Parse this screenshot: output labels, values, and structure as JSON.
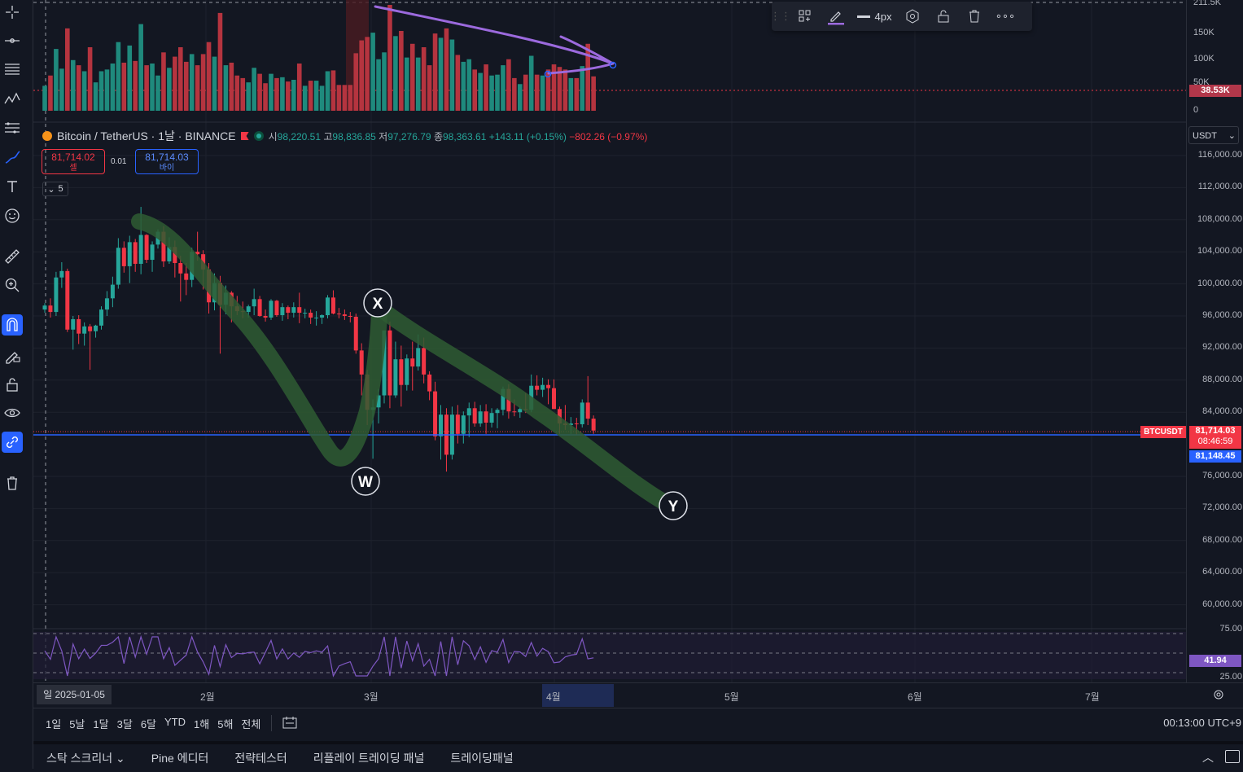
{
  "header": {
    "symbol": "Bitcoin / TetherUS · 1날 · BINANCE",
    "ohlc": {
      "open_label": "시",
      "open": "98,220.51",
      "high_label": "고",
      "high": "98,836.85",
      "low_label": "저",
      "low": "97,276.79",
      "close_label": "종",
      "close": "98,363.61",
      "change": "+143.11 (+0.15%)",
      "change2": "−802.26 (−0.97%)"
    }
  },
  "trade": {
    "sell_price": "81,714.02",
    "sell_label": "셀",
    "spread": "0.01",
    "buy_price": "81,714.03",
    "buy_label": "바이",
    "collapse_count": "5"
  },
  "draw_toolbar": {
    "width_label": "4px"
  },
  "price_axis": {
    "currency": "USDT",
    "labels": [
      "116,000.00",
      "112,000.00",
      "108,000.00",
      "104,000.00",
      "100,000.00",
      "96,000.00",
      "92,000.00",
      "88,000.00",
      "84,000.00",
      "76,000.00",
      "72,000.00",
      "68,000.00",
      "64,000.00",
      "60,000.00"
    ],
    "last_price": "81,714.03",
    "countdown": "08:46:59",
    "line_price": "81,148.45",
    "symbol_tag": "BTCUSDT"
  },
  "volume_axis": {
    "labels": [
      "211.5K",
      "150K",
      "100K",
      "50K",
      "0"
    ],
    "current": "38.53K"
  },
  "rsi_axis": {
    "top": "75.00",
    "bottom": "25.00",
    "value": "41.94"
  },
  "wave_labels": {
    "w": "W",
    "x": "X",
    "y": "Y"
  },
  "time_axis": {
    "current_date": "일 2025-01-05",
    "months": [
      "2월",
      "3월",
      "4월",
      "5월",
      "6월",
      "7월"
    ]
  },
  "range_bar": {
    "buttons": [
      "1일",
      "5날",
      "1달",
      "3달",
      "6달",
      "YTD",
      "1해",
      "5해",
      "전체"
    ],
    "clock": "00:13:00 UTC+9"
  },
  "bottom_tabs": [
    "스탁 스크리너",
    "Pine 에디터",
    "전략테스터",
    "리플레이 트레이딩 패널",
    "트레이딩패널"
  ],
  "colors": {
    "up": "#26a69a",
    "down": "#f23645",
    "accent": "#2962ff",
    "background": "#131722",
    "wave": "#2f5c32",
    "drawing": "#9c6ade"
  },
  "chart_data": {
    "type": "candlestick",
    "title": "Bitcoin / TetherUS · 1날 · BINANCE",
    "ylim": [
      58000,
      118000
    ],
    "x_range": [
      "2025-01-05",
      "2025-07-31"
    ],
    "candles": [
      [
        96800,
        97600,
        96400,
        97300
      ],
      [
        97300,
        98200,
        95800,
        96500
      ],
      [
        96500,
        101500,
        96000,
        100800
      ],
      [
        100800,
        102700,
        99500,
        101600
      ],
      [
        101600,
        101900,
        94000,
        94300
      ],
      [
        94300,
        96000,
        91800,
        95600
      ],
      [
        95600,
        96100,
        92500,
        93800
      ],
      [
        93800,
        95200,
        92300,
        94700
      ],
      [
        94700,
        95000,
        89300,
        94100
      ],
      [
        94100,
        94900,
        93300,
        94800
      ],
      [
        94800,
        97200,
        94300,
        96800
      ],
      [
        96800,
        99100,
        96000,
        98200
      ],
      [
        98200,
        100900,
        97100,
        99900
      ],
      [
        99900,
        105700,
        99400,
        104500
      ],
      [
        104500,
        105300,
        101400,
        102200
      ],
      [
        102200,
        106000,
        100100,
        105200
      ],
      [
        105200,
        105600,
        101500,
        102500
      ],
      [
        102500,
        109600,
        101200,
        106100
      ],
      [
        106100,
        106200,
        102600,
        103000
      ],
      [
        103000,
        105300,
        101500,
        104900
      ],
      [
        104900,
        106800,
        104400,
        106500
      ],
      [
        106500,
        107200,
        102100,
        102800
      ],
      [
        102800,
        105800,
        102500,
        104600
      ],
      [
        104600,
        105400,
        100800,
        102600
      ],
      [
        102600,
        103500,
        97800,
        101300
      ],
      [
        101300,
        102600,
        98600,
        100500
      ],
      [
        100500,
        104500,
        99600,
        104000
      ],
      [
        104000,
        106500,
        102900,
        103700
      ],
      [
        103700,
        104200,
        99300,
        101800
      ],
      [
        101800,
        102600,
        96300,
        97700
      ],
      [
        97700,
        101300,
        96700,
        100100
      ],
      [
        100100,
        101000,
        91300,
        97400
      ],
      [
        97400,
        99800,
        96200,
        98900
      ],
      [
        98900,
        99100,
        95200,
        97200
      ],
      [
        97200,
        98500,
        96100,
        96600
      ],
      [
        96600,
        97800,
        95700,
        96500
      ],
      [
        96500,
        97400,
        95800,
        97200
      ],
      [
        97200,
        99400,
        96100,
        98100
      ],
      [
        98100,
        98500,
        95900,
        96000
      ],
      [
        96000,
        96800,
        95300,
        95800
      ],
      [
        95800,
        98100,
        95500,
        97900
      ],
      [
        97900,
        98000,
        95900,
        96100
      ],
      [
        96100,
        97600,
        95400,
        97100
      ],
      [
        97100,
        97300,
        95600,
        96400
      ],
      [
        96400,
        97700,
        95800,
        97100
      ],
      [
        97100,
        98900,
        95100,
        96400
      ],
      [
        96400,
        96900,
        95700,
        96400
      ],
      [
        96400,
        96800,
        95000,
        95800
      ],
      [
        95800,
        96600,
        94800,
        95800
      ],
      [
        95800,
        96200,
        95000,
        96100
      ],
      [
        96100,
        98600,
        95700,
        98300
      ],
      [
        98300,
        99200,
        96200,
        96300
      ],
      [
        96300,
        97000,
        95700,
        96200
      ],
      [
        96200,
        96800,
        95500,
        96000
      ],
      [
        96000,
        96500,
        95200,
        95900
      ],
      [
        95900,
        96300,
        91300,
        91700
      ],
      [
        91700,
        92600,
        86100,
        88700
      ],
      [
        88700,
        89300,
        82400,
        84300
      ],
      [
        84300,
        85600,
        78200,
        84600
      ],
      [
        84600,
        86900,
        82600,
        86100
      ],
      [
        86100,
        90200,
        85100,
        94200
      ],
      [
        94200,
        95300,
        84500,
        86100
      ],
      [
        86100,
        92800,
        85800,
        90600
      ],
      [
        90600,
        92300,
        84700,
        87400
      ],
      [
        87400,
        91200,
        86700,
        90700
      ],
      [
        90700,
        92800,
        86700,
        89700
      ],
      [
        89700,
        93700,
        89200,
        92000
      ],
      [
        92000,
        93300,
        87600,
        88700
      ],
      [
        88700,
        89100,
        85500,
        86600
      ],
      [
        86600,
        87800,
        80500,
        81000
      ],
      [
        81000,
        84900,
        78100,
        83700
      ],
      [
        83700,
        84500,
        76600,
        78700
      ],
      [
        78700,
        84700,
        78100,
        83700
      ],
      [
        83700,
        84900,
        80100,
        81300
      ],
      [
        81300,
        84100,
        80100,
        83600
      ],
      [
        83600,
        85200,
        80900,
        84500
      ],
      [
        84500,
        85300,
        82200,
        82600
      ],
      [
        82600,
        84900,
        82200,
        84100
      ],
      [
        84100,
        85000,
        81300,
        82700
      ],
      [
        82700,
        84500,
        82100,
        83900
      ],
      [
        83900,
        84500,
        82000,
        84300
      ],
      [
        84300,
        87200,
        83600,
        86900
      ],
      [
        86900,
        87500,
        83200,
        84100
      ],
      [
        84100,
        85600,
        83500,
        84000
      ],
      [
        84000,
        84700,
        83300,
        84400
      ],
      [
        84400,
        86400,
        83900,
        84300
      ],
      [
        84300,
        88700,
        84000,
        87300
      ],
      [
        87300,
        88600,
        86100,
        86800
      ],
      [
        86800,
        88300,
        85900,
        87400
      ],
      [
        87400,
        88100,
        85000,
        87000
      ],
      [
        87000,
        88100,
        84400,
        84400
      ],
      [
        84400,
        84700,
        81300,
        82600
      ],
      [
        82600,
        84900,
        81800,
        82400
      ],
      [
        82400,
        83400,
        81300,
        82600
      ],
      [
        82600,
        83300,
        81200,
        82500
      ],
      [
        82500,
        85600,
        82100,
        85200
      ],
      [
        85200,
        88500,
        82400,
        83200
      ],
      [
        83200,
        83600,
        81300,
        81714
      ]
    ],
    "annotations": [
      "W",
      "X",
      "Y"
    ]
  }
}
